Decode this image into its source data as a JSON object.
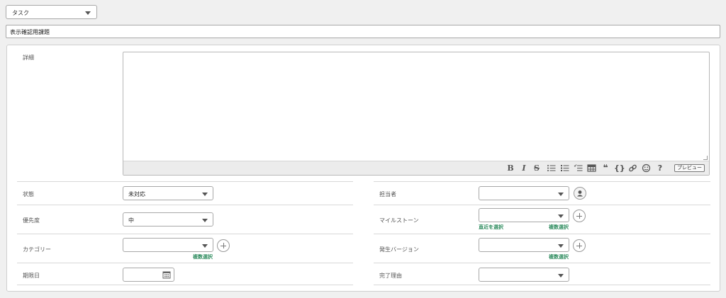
{
  "issue_type": {
    "value": "タスク"
  },
  "summary": {
    "value": "表示確認用課題"
  },
  "details": {
    "label": "詳細",
    "toolbar": {
      "preview_label": "プレビュー"
    }
  },
  "left_fields": {
    "status": {
      "label": "状態",
      "value": "未対応"
    },
    "priority": {
      "label": "優先度",
      "value": "中"
    },
    "category": {
      "label": "カテゴリー",
      "value": "",
      "multi_select": "複数選択"
    },
    "due_date": {
      "label": "期限日",
      "value": ""
    }
  },
  "right_fields": {
    "assignee": {
      "label": "担当者",
      "value": ""
    },
    "milestone": {
      "label": "マイルストーン",
      "value": "",
      "recent_select": "直近を選択",
      "multi_select": "複数選択"
    },
    "version": {
      "label": "発生バージョン",
      "value": "",
      "multi_select": "複数選択"
    },
    "resolution": {
      "label": "完了理由",
      "value": ""
    }
  },
  "colors": {
    "link": "#2b8a5c",
    "background": "#f0f0f0"
  }
}
